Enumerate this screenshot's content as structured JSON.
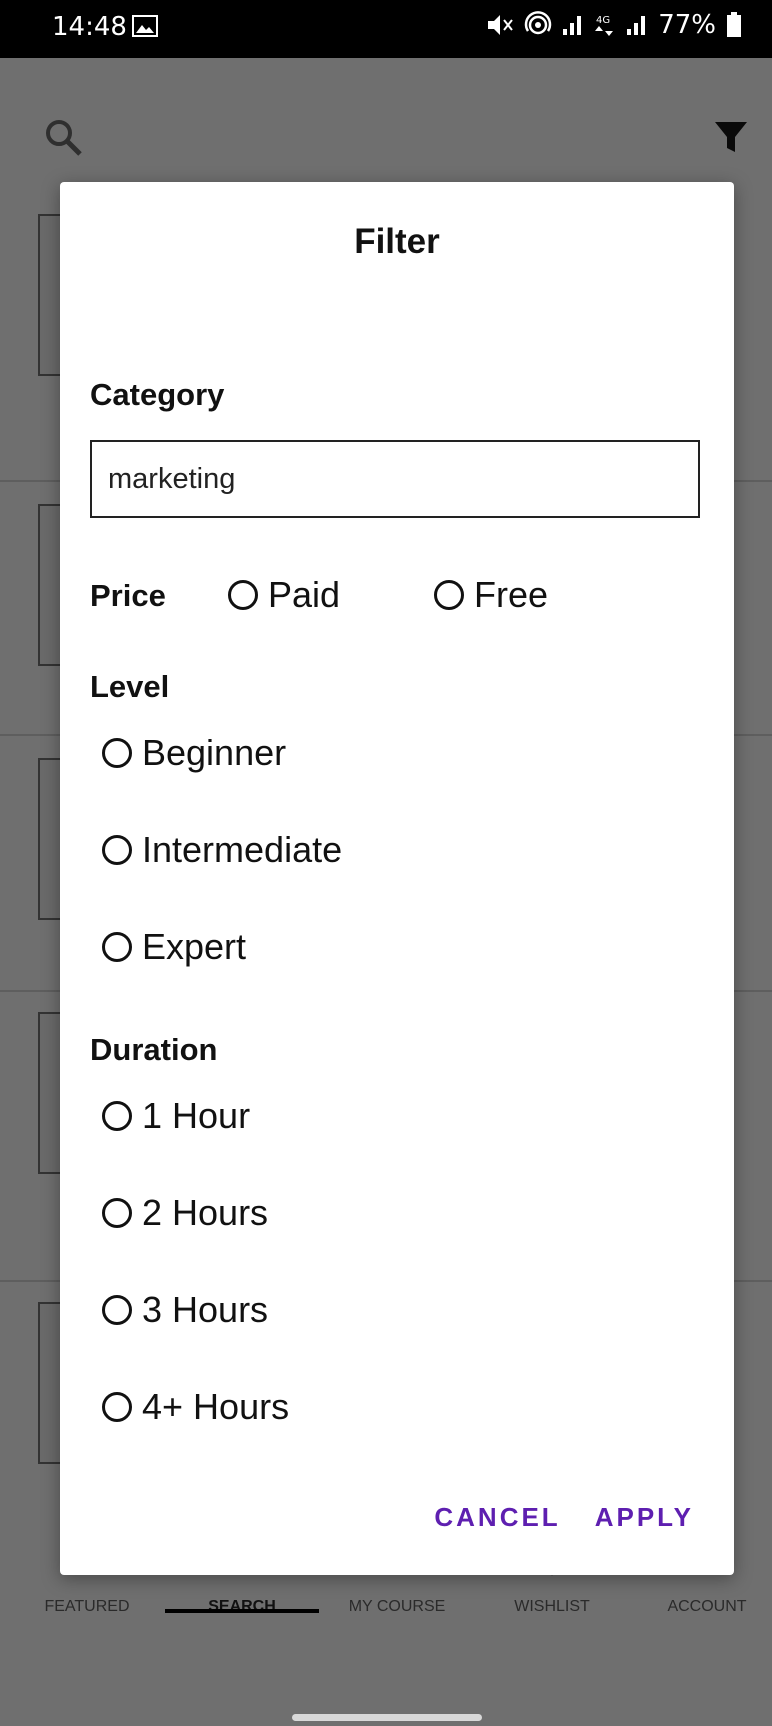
{
  "status_bar": {
    "time": "14:48",
    "battery": "77%",
    "icons": [
      "gallery-icon",
      "mute-icon",
      "hotspot-icon",
      "signal-icon",
      "4g-icon",
      "battery-icon"
    ]
  },
  "nav": {
    "items": [
      {
        "label": "FEATURED",
        "icon": "star-icon"
      },
      {
        "label": "SEARCH",
        "icon": "search-icon"
      },
      {
        "label": "MY COURSE",
        "icon": "book-icon"
      },
      {
        "label": "WISHLIST",
        "icon": "heart-icon"
      },
      {
        "label": "ACCOUNT",
        "icon": "account-icon"
      }
    ],
    "active": "SEARCH"
  },
  "filter_dialog": {
    "title": "Filter",
    "category": {
      "label": "Category",
      "value": "marketing"
    },
    "price": {
      "label": "Price",
      "options": [
        "Paid",
        "Free"
      ]
    },
    "level": {
      "label": "Level",
      "options": [
        "Beginner",
        "Intermediate",
        "Expert"
      ]
    },
    "duration": {
      "label": "Duration",
      "options": [
        "1 Hour",
        "2 Hours",
        "3 Hours",
        "4+ Hours"
      ]
    },
    "actions": {
      "cancel": "CANCEL",
      "apply": "APPLY"
    }
  },
  "colors": {
    "accent": "#5e1fb0",
    "scrim": "#6f6f6f",
    "dialog_bg": "#ffffff"
  }
}
